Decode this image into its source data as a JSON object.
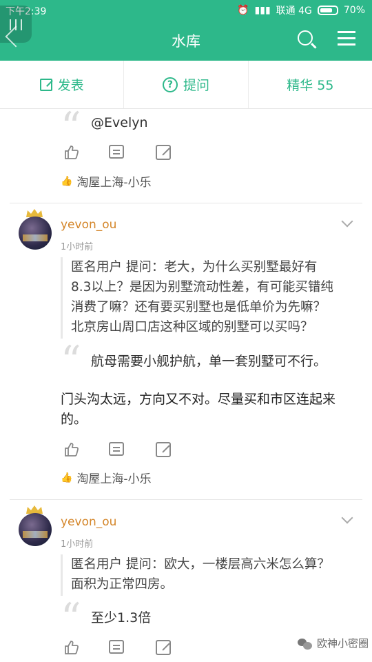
{
  "status_bar": {
    "time": "下午2:39",
    "carrier": "联通 4G",
    "battery": "70%"
  },
  "header": {
    "title": "水库"
  },
  "tabs": [
    {
      "label": "发表"
    },
    {
      "label": "提问"
    },
    {
      "label": "精华 55"
    }
  ],
  "posts": [
    {
      "quote_text": "@Evelyn",
      "liked_by": "淘屋上海-小乐"
    },
    {
      "username": "yevon_ou",
      "time_ago": "1小时前",
      "question_lines": [
        "匿名用户  提问：老大，为什么买别墅最好有",
        "8.3以上？是因为别墅流动性差，有可能买错纯",
        "消费了嘛？还有要买别墅也是低单价为先嘛？",
        "北京房山周口店这种区域的别墅可以买吗？"
      ],
      "answer_quote": "航母需要小舰护航，单一套别墅可不行。",
      "reply_lines": [
        "门头沟太远，方向又不对。尽量买和市区连起来",
        "的。"
      ],
      "liked_by": "淘屋上海-小乐"
    },
    {
      "username": "yevon_ou",
      "time_ago": "1小时前",
      "question_lines": [
        "匿名用户  提问：欧大，一楼层高六米怎么算？",
        "面积为正常四房。"
      ],
      "answer_quote": "至少1.3倍"
    }
  ],
  "watermark": {
    "label": "欧神小密圈"
  },
  "colors": {
    "accent": "#2db88a",
    "username": "#d4862a"
  }
}
